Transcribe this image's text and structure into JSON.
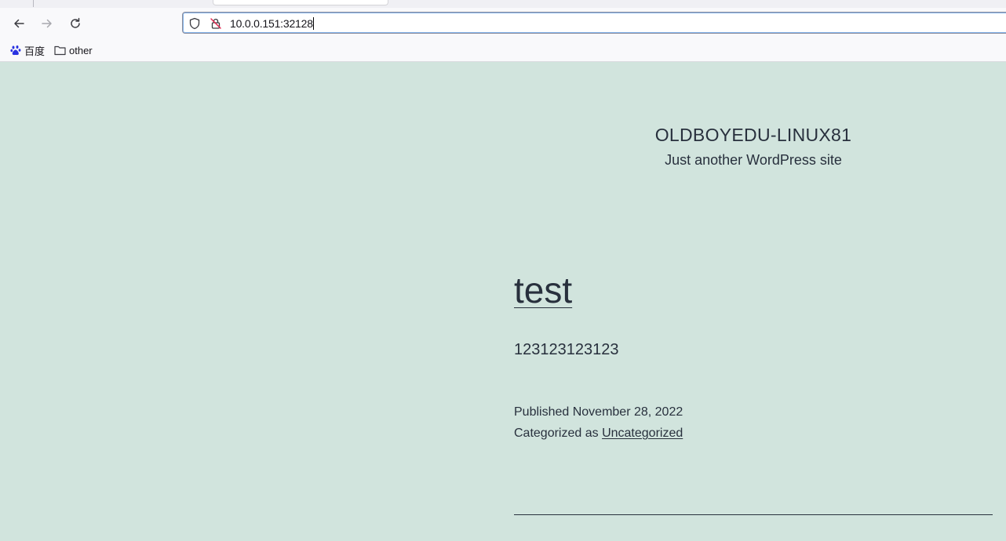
{
  "browser": {
    "address": "10.0.0.151:32128",
    "bookmarks": [
      {
        "label": "百度",
        "icon": "baidu-paw-icon"
      },
      {
        "label": "other",
        "icon": "folder-icon"
      }
    ]
  },
  "site": {
    "title": "OLDBOYEDU-LINUX81",
    "description": "Just another WordPress site"
  },
  "post": {
    "title": "test",
    "body": "123123123123",
    "published": "Published November 28, 2022",
    "categorized_prefix": "Categorized as",
    "category": "Uncategorized"
  },
  "colors": {
    "page_background": "#d1e4dd",
    "text": "#28303d"
  }
}
